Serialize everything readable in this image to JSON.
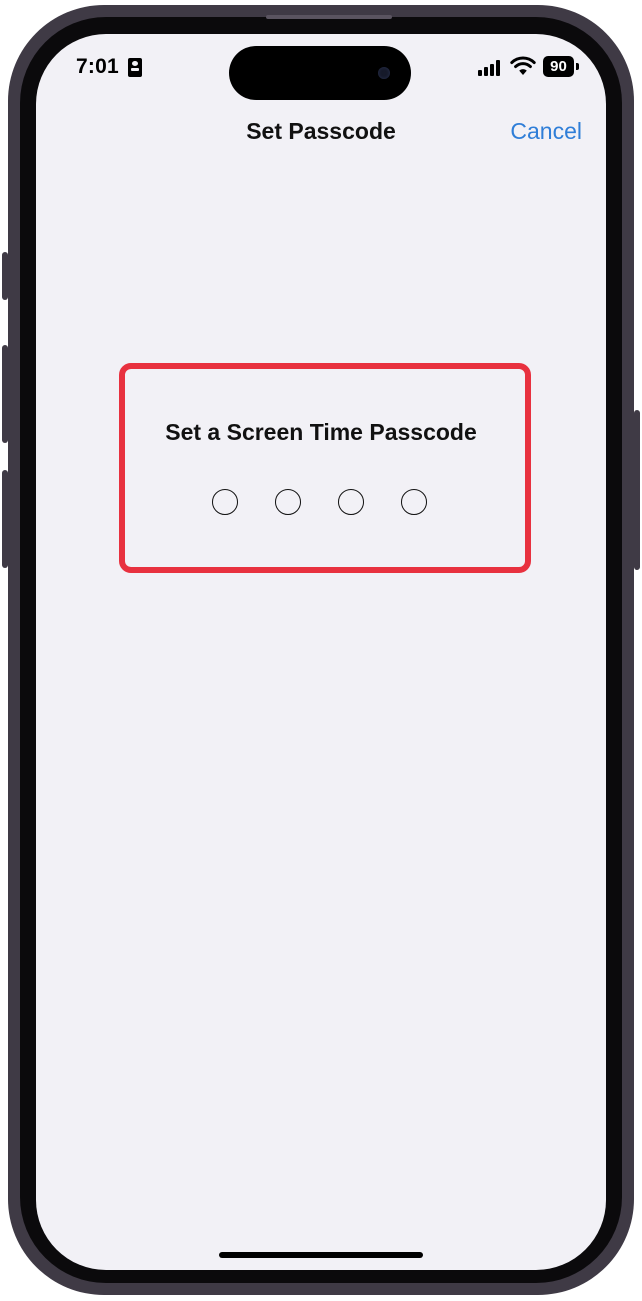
{
  "status_bar": {
    "time": "7:01",
    "battery_level": "90",
    "icons": [
      "contact-card-icon",
      "cellular-signal-icon",
      "wifi-icon",
      "battery-icon"
    ]
  },
  "nav_bar": {
    "title": "Set Passcode",
    "cancel_label": "Cancel",
    "accent_color": "#2f7ed8"
  },
  "passcode": {
    "prompt": "Set a Screen Time Passcode",
    "digits_total": 4,
    "digits_entered": 0
  },
  "highlight": {
    "color": "#e8313f"
  }
}
